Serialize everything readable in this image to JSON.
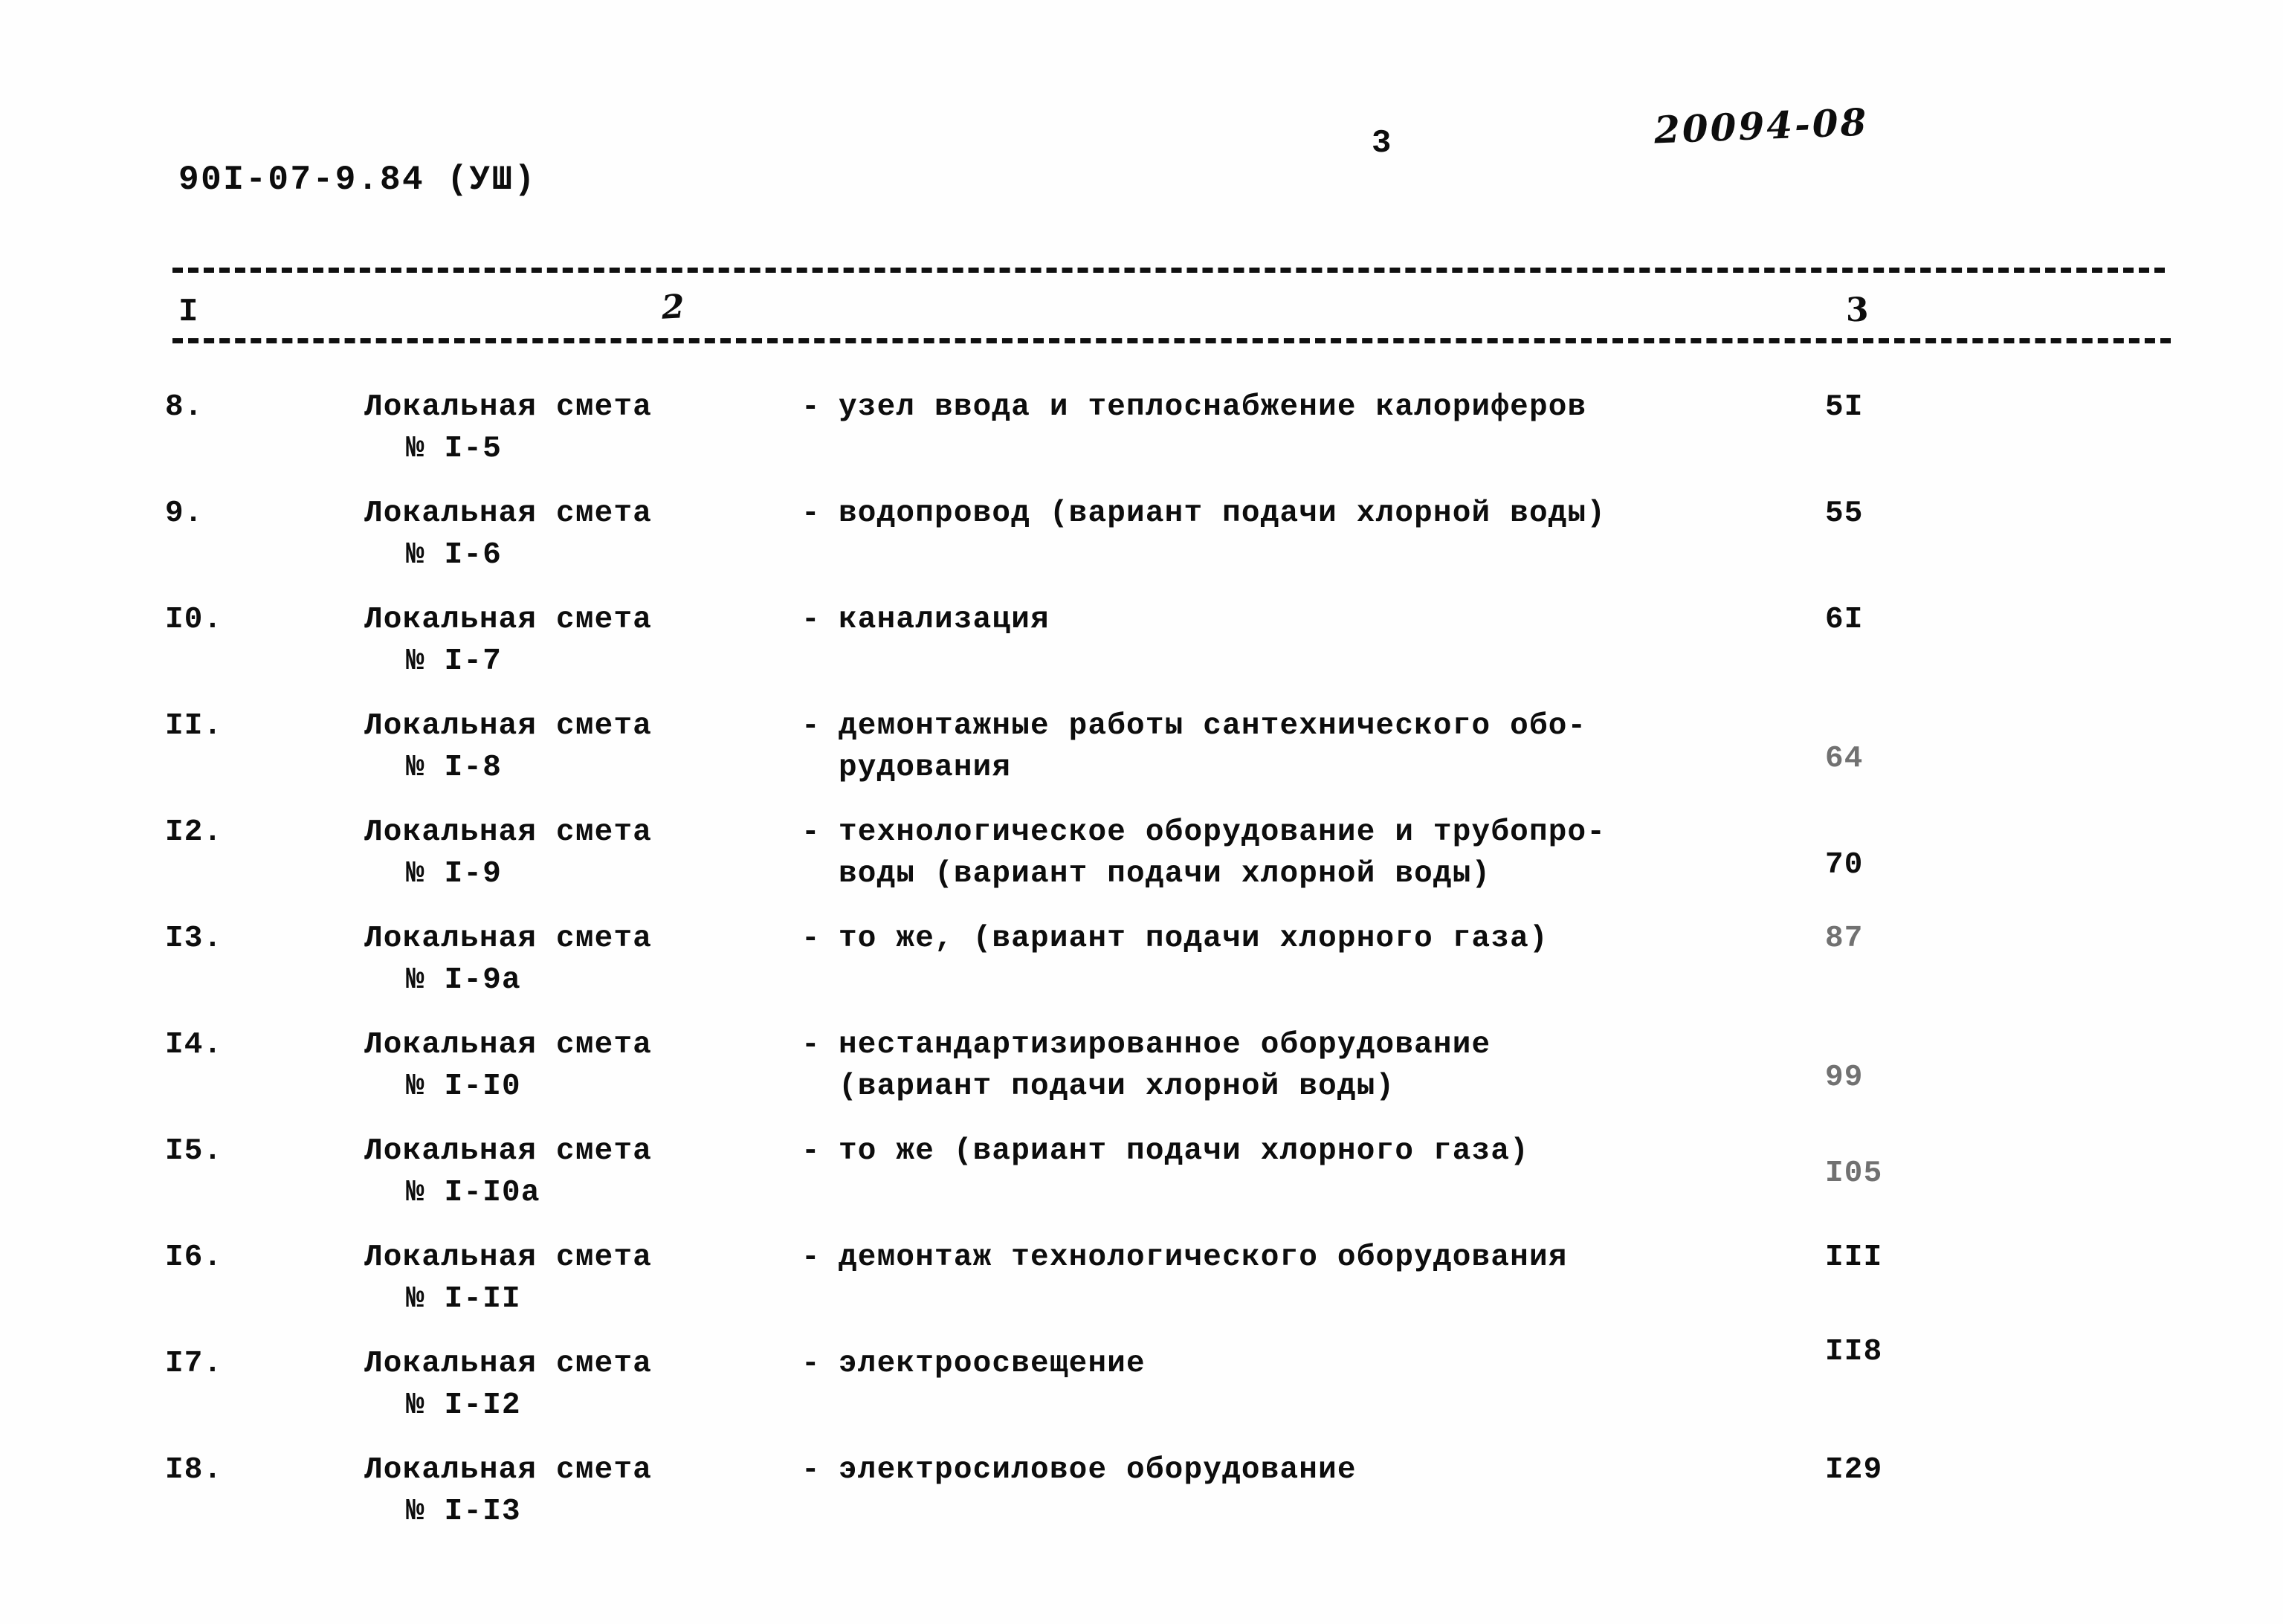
{
  "header": {
    "doc_code": "90I-07-9.84 (УШ)",
    "page_number": "3",
    "archive_mark": "20094-08"
  },
  "table": {
    "column_headers": [
      "I",
      "2",
      "3"
    ],
    "rows": [
      {
        "num": "8.",
        "kind": "Локальная смета",
        "kind_sub": "№ I-5",
        "dash": "-",
        "desc_line1": "узел ввода и теплоснабжение калориферов",
        "desc_line2": "",
        "page": "5I"
      },
      {
        "num": "9.",
        "kind": "Локальная смета",
        "kind_sub": "№ I-6",
        "dash": "-",
        "desc_line1": "водопровод (вариант подачи хлорной воды)",
        "desc_line2": "",
        "page": "55"
      },
      {
        "num": "I0.",
        "kind": "Локальная смета",
        "kind_sub": "№ I-7",
        "dash": "-",
        "desc_line1": "канализация",
        "desc_line2": "",
        "page": "6I"
      },
      {
        "num": "II.",
        "kind": "Локальная смета",
        "kind_sub": "№ I-8",
        "dash": "-",
        "desc_line1": "демонтажные работы сантехнического обо-",
        "desc_line2": "рудования",
        "page": "64"
      },
      {
        "num": "I2.",
        "kind": "Локальная смета",
        "kind_sub": "№ I-9",
        "dash": "-",
        "desc_line1": "технологическое оборудование и трубопро-",
        "desc_line2": "воды (вариант подачи хлорной воды)",
        "page": "70"
      },
      {
        "num": "I3.",
        "kind": "Локальная смета",
        "kind_sub": "№ I-9а",
        "dash": "-",
        "desc_line1": "то же, (вариант подачи хлорного газа)",
        "desc_line2": "",
        "page": "87"
      },
      {
        "num": "I4.",
        "kind": "Локальная смета",
        "kind_sub": "№ I-I0",
        "dash": "-",
        "desc_line1": "нестандартизированное оборудование",
        "desc_line2": "(вариант подачи хлорной воды)",
        "page": "99"
      },
      {
        "num": "I5.",
        "kind": "Локальная смета",
        "kind_sub": "№ I-I0а",
        "dash": "-",
        "desc_line1": "то же (вариант подачи хлорного газа)",
        "desc_line2": "",
        "page": "I05"
      },
      {
        "num": "I6.",
        "kind": "Локальная смета",
        "kind_sub": "№ I-II",
        "dash": "-",
        "desc_line1": "демонтаж технологического оборудования",
        "desc_line2": "",
        "page": "III"
      },
      {
        "num": "I7.",
        "kind": "Локальная смета",
        "kind_sub": "№ I-I2",
        "dash": "-",
        "desc_line1": "электроосвещение",
        "desc_line2": "",
        "page": "II8"
      },
      {
        "num": "I8.",
        "kind": "Локальная смета",
        "kind_sub": "№ I-I3",
        "dash": "-",
        "desc_line1": "электросиловое оборудование",
        "desc_line2": "",
        "page": "I29"
      }
    ]
  }
}
